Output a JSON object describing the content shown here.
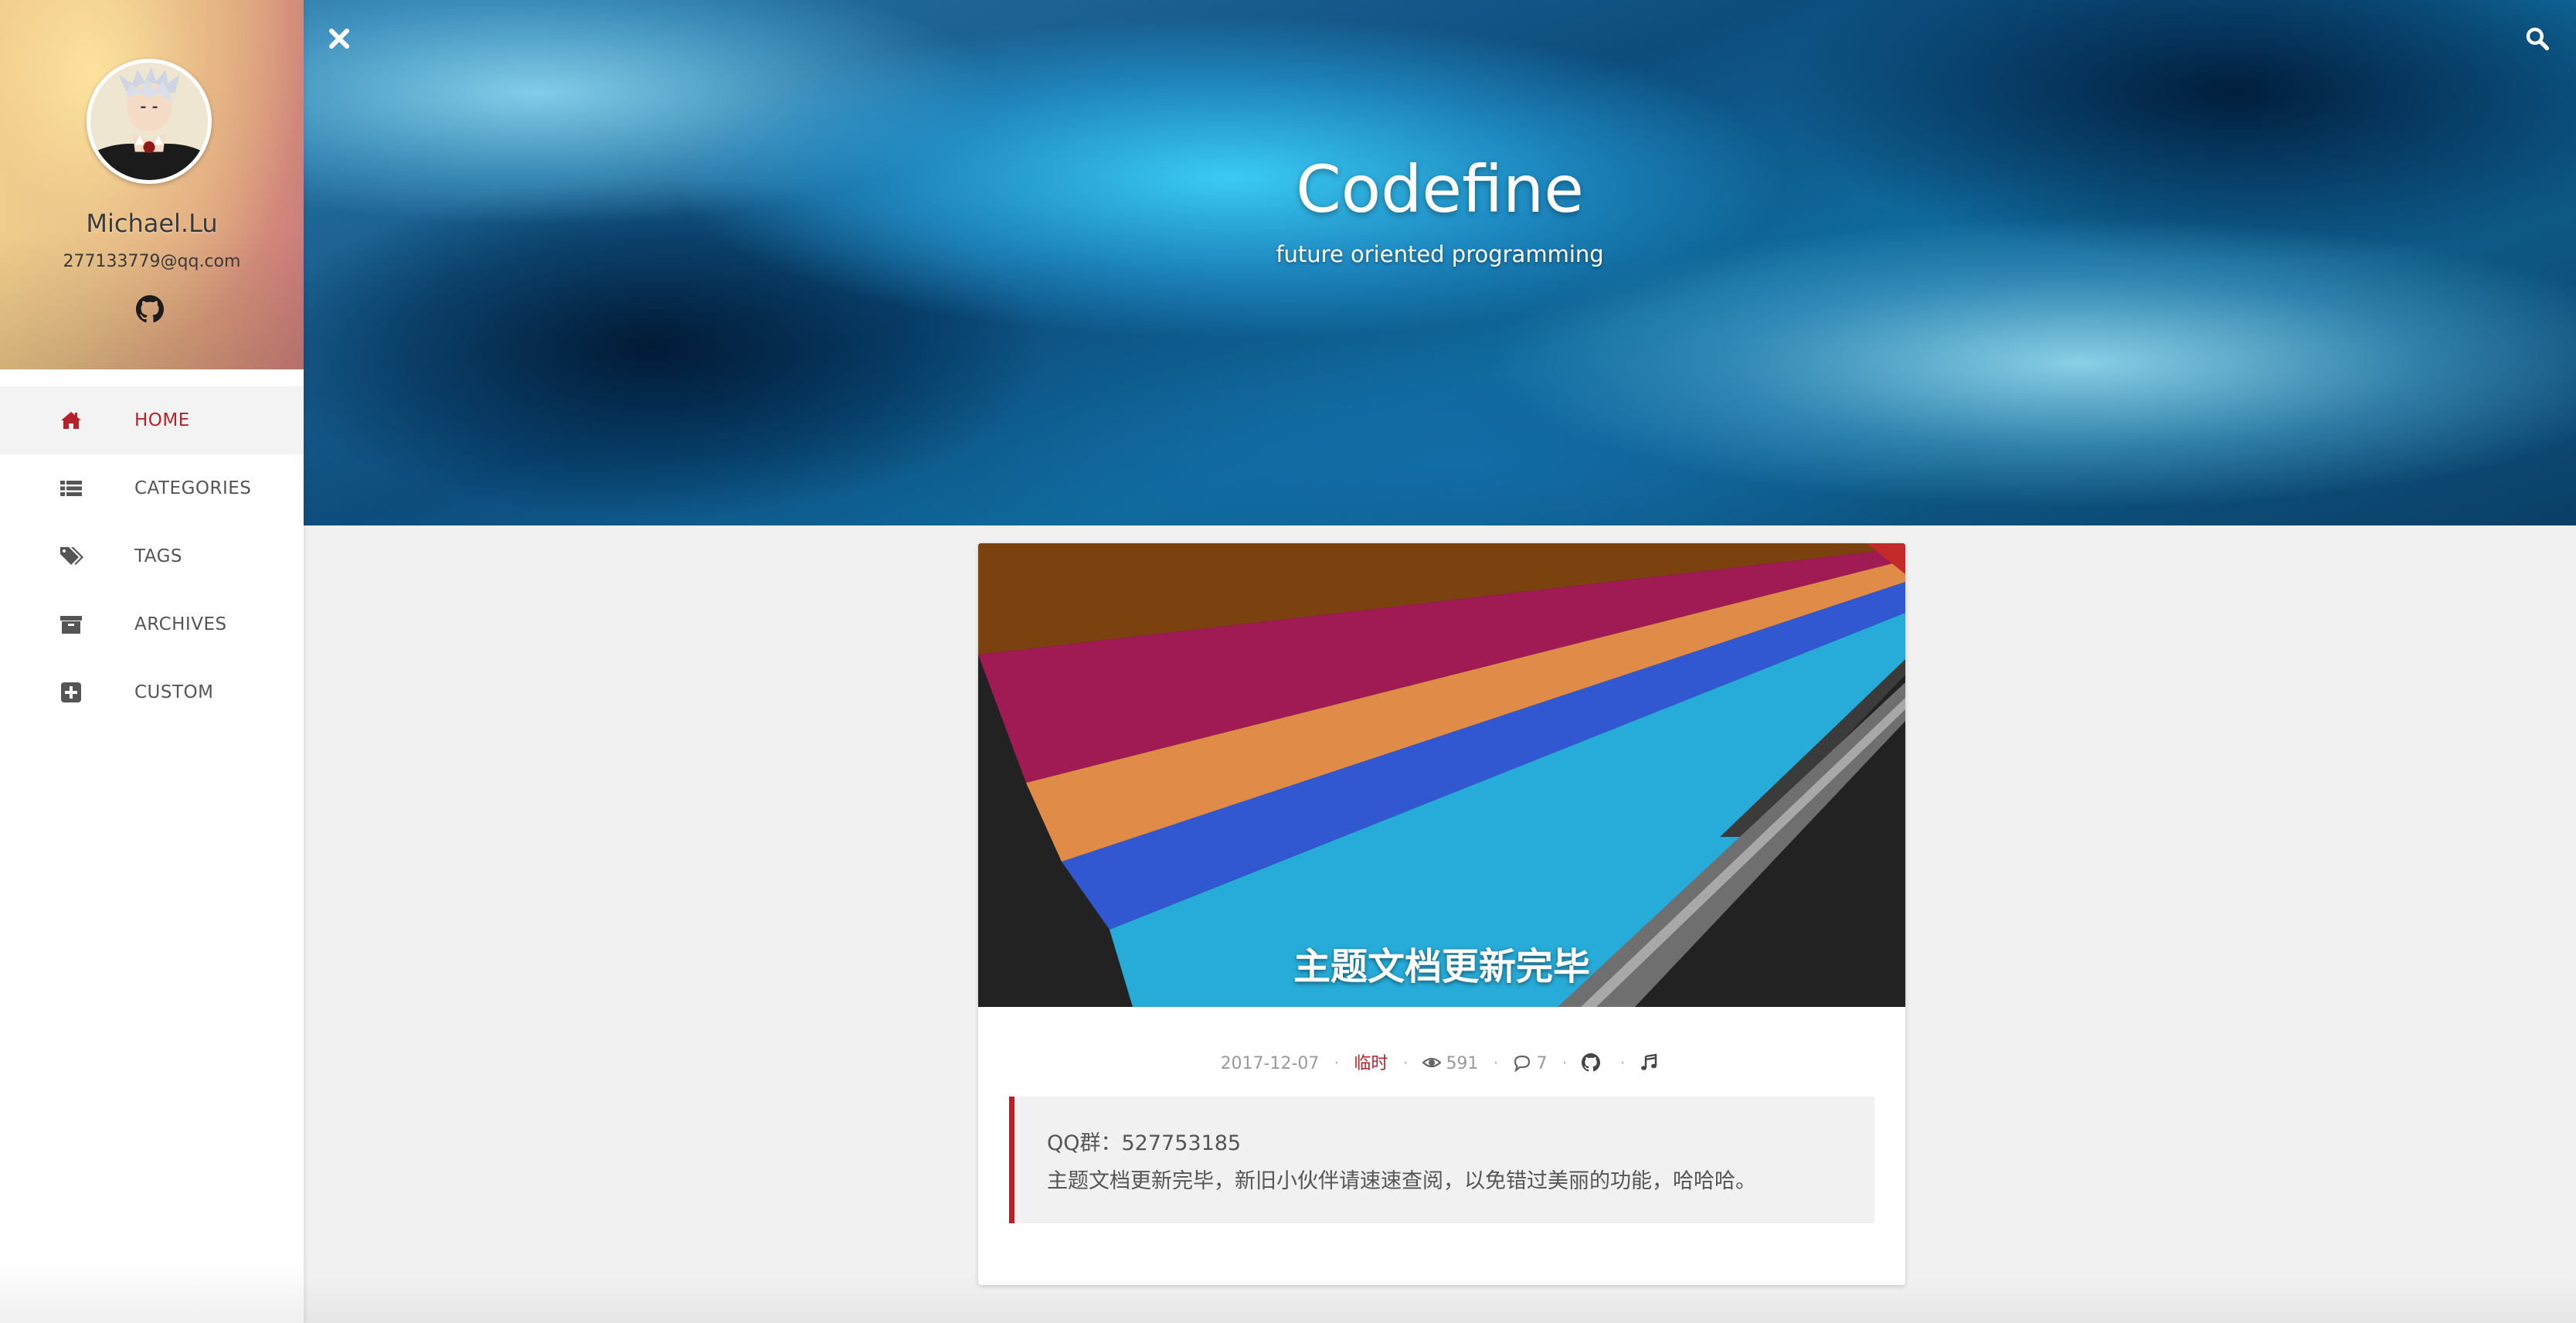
{
  "profile": {
    "name": "Michael.Lu",
    "email": "277133779@qq.com",
    "avatar_alt": "avatar",
    "social_icon": "github-icon"
  },
  "nav": {
    "items": [
      {
        "label": "HOME",
        "icon": "home-icon",
        "active": true
      },
      {
        "label": "CATEGORIES",
        "icon": "list-icon",
        "active": false
      },
      {
        "label": "TAGS",
        "icon": "tags-icon",
        "active": false
      },
      {
        "label": "ARCHIVES",
        "icon": "archive-icon",
        "active": false
      },
      {
        "label": "CUSTOM",
        "icon": "plus-square-icon",
        "active": false
      }
    ]
  },
  "header": {
    "title": "Codefine",
    "subtitle": "future oriented programming",
    "close_icon": "close-icon",
    "search_icon": "search-icon"
  },
  "post": {
    "title": "主题文档更新完毕",
    "date": "2017-12-07",
    "category": "临时",
    "views": "591",
    "comments": "7",
    "excerpt_line1": "QQ群：527753185",
    "excerpt_line2": "主题文档更新完毕，新旧小伙伴请速速查阅，以免错过美丽的功能，哈哈哈。"
  },
  "colors": {
    "accent": "#b5232a",
    "sidebar_bg": "#ffffff",
    "page_bg": "#f1f1f1",
    "text_muted": "#9a9a9a"
  }
}
